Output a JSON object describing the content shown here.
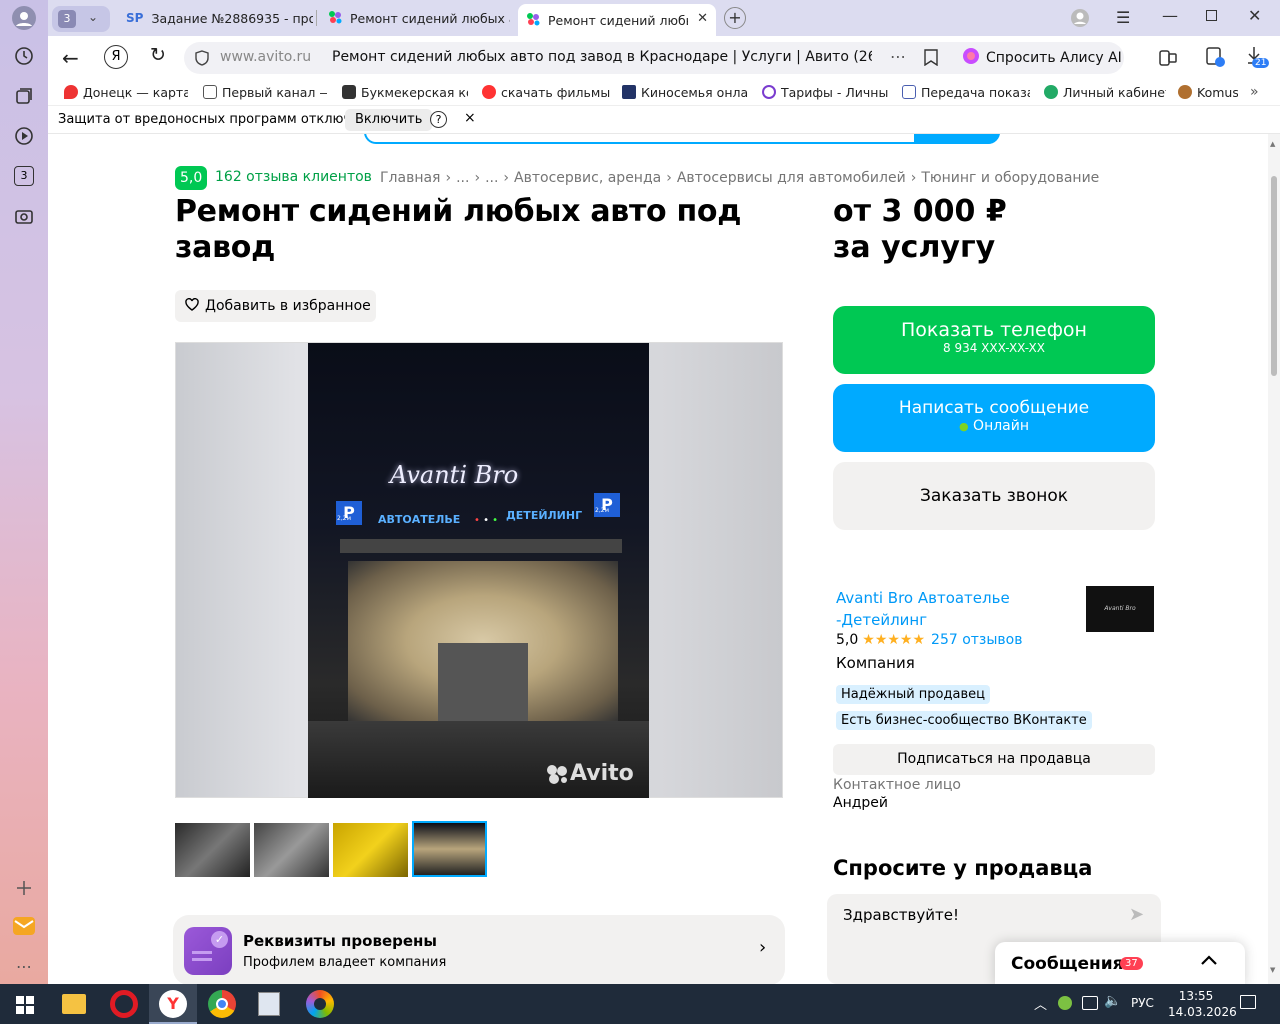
{
  "tabs": [
    {
      "label": "Задание №2886935 - про"
    },
    {
      "label": "Ремонт сидений любых а"
    },
    {
      "label": "Ремонт сидений любы"
    }
  ],
  "tab_group_count": "3",
  "address": {
    "domain": "www.avito.ru",
    "title": "Ремонт сидений любых авто под завод в Краснодаре | Услуги | Авито (26…",
    "alice": "Спросить Алису AI",
    "downloads_badge": "21"
  },
  "bookmarks": [
    {
      "label": "Донецк — карта, с"
    },
    {
      "label": "Первый канал — с"
    },
    {
      "label": "Букмекерская кон"
    },
    {
      "label": "скачать фильмы 2"
    },
    {
      "label": "Киносемья онлай"
    },
    {
      "label": "Тарифы - Личный"
    },
    {
      "label": "Передача показан"
    },
    {
      "label": "Личный кабинет"
    },
    {
      "label": "Komus"
    }
  ],
  "infobar": {
    "text": "Защита от вредоносных программ отключена",
    "button": "Включить",
    "help": "?",
    "close": "×"
  },
  "sidebar": {
    "badge": "3"
  },
  "listing": {
    "rating": "5,0",
    "reviews_link": "162 отзыва клиентов",
    "breadcrumbs": [
      "Главная",
      "...",
      "...",
      "Автосервис, аренда",
      "Автосервисы для автомобилей",
      "Тюнинг и оборудование"
    ],
    "title": "Ремонт сидений любых авто под завод",
    "favorite": "Добавить в избранное",
    "price": "от 3 000 ₽",
    "price_unit": "за услугу",
    "watermark": "Avito",
    "verified_title": "Реквизиты проверены",
    "verified_sub": "Профилем владеет компания"
  },
  "photo_signs": {
    "brand": "Avanti Bro",
    "left": "АВТОАТЕЛЬЕ",
    "right": "ДЕТЕЙЛИНГ",
    "height1": "2,2м",
    "height2": "2,2м"
  },
  "contact": {
    "phone_btn": "Показать телефон",
    "phone": "8 934 XXX-XX-XX",
    "message_btn": "Написать сообщение",
    "online": "Онлайн",
    "callback_btn": "Заказать звонок"
  },
  "seller": {
    "name_line1": "Avanti Bro Автоателье",
    "name_line2": "-Детейлинг",
    "rating": "5,0",
    "stars": "★★★★★",
    "reviews": "257 отзывов",
    "type": "Компания",
    "badges": [
      "Надёжный продавец",
      "Есть бизнес-сообщество ВКонтакте"
    ],
    "subscribe": "Подписаться на продавца",
    "contact_label": "Контактное лицо",
    "contact_name": "Андрей"
  },
  "ask": {
    "title": "Спросите у продавца",
    "message": "Здравствуйте!"
  },
  "messages": {
    "label": "Сообщения",
    "count": "37"
  },
  "taskbar": {
    "lang": "РУС",
    "time": "13:55",
    "date": "14.03.2026"
  },
  "colors": {
    "green": "#00c853",
    "blue": "#00aaff",
    "accent_link": "#0099f7"
  }
}
